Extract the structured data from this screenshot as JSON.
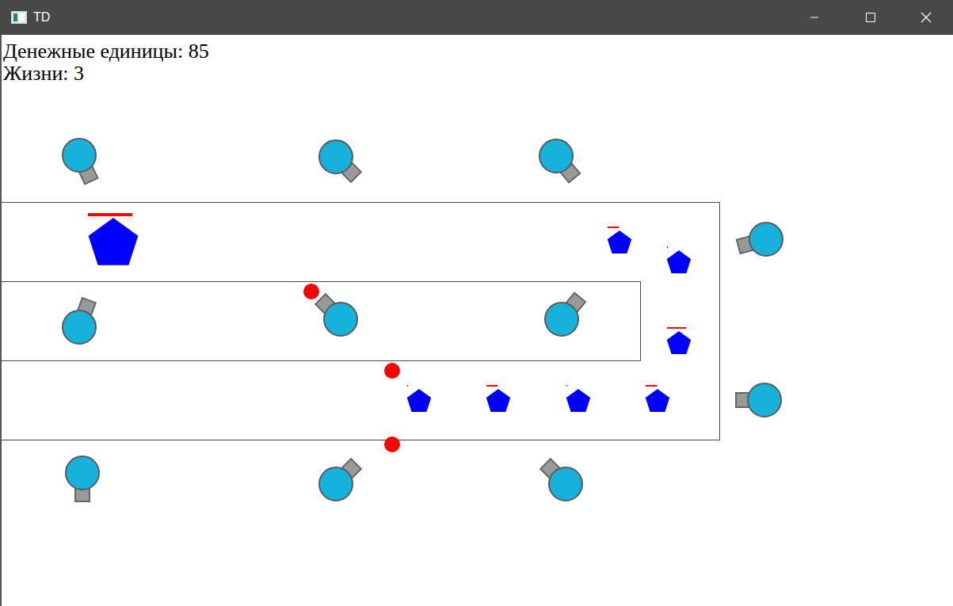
{
  "window": {
    "title": "TD"
  },
  "hud": {
    "money": "Денежные единицы: 85",
    "lives": "Жизни: 3"
  },
  "towers": [
    {
      "angle": 65
    },
    {
      "angle": 45
    },
    {
      "angle": 50
    },
    {
      "angle": 165
    },
    {
      "angle": -70
    },
    {
      "angle": -135
    },
    {
      "angle": -50
    },
    {
      "angle": 180
    },
    {
      "angle": 90
    },
    {
      "angle": -45
    },
    {
      "angle": -135
    }
  ],
  "enemies": [
    {
      "kind": "boss",
      "health": 1.0
    },
    {
      "kind": "normal",
      "health": 0.6
    },
    {
      "kind": "normal",
      "health": 0.05
    },
    {
      "kind": "normal",
      "health": 1.0
    },
    {
      "kind": "normal",
      "health": 0.05
    },
    {
      "kind": "normal",
      "health": 0.6
    },
    {
      "kind": "normal",
      "health": 0.05
    },
    {
      "kind": "normal",
      "health": 0.6
    }
  ],
  "bullets": [
    {
      "kind": "bullet"
    },
    {
      "kind": "bullet"
    },
    {
      "kind": "bullet"
    }
  ]
}
